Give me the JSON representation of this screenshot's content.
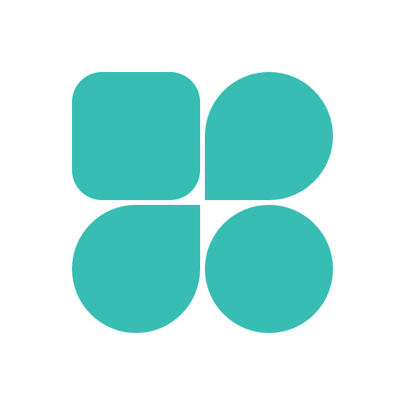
{
  "logo": {
    "icon_name": "four-petal-app-icon",
    "color": "#38BDB4",
    "background": "#FFFFFF"
  }
}
